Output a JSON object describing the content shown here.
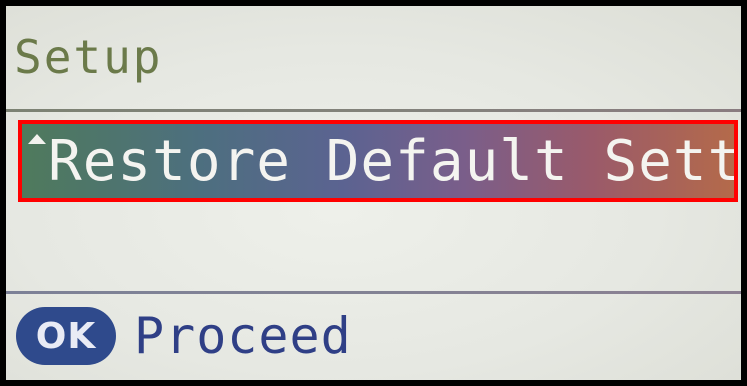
{
  "header": {
    "title": "Setup"
  },
  "menu": {
    "selected_item": "Restore Default Setting",
    "scroll_indicator_icon": "triangle-up-icon",
    "highlight_color": "#ff0000"
  },
  "footer": {
    "button_icon": "ok-button-icon",
    "button_label": "OK",
    "action_label": "Proceed"
  }
}
